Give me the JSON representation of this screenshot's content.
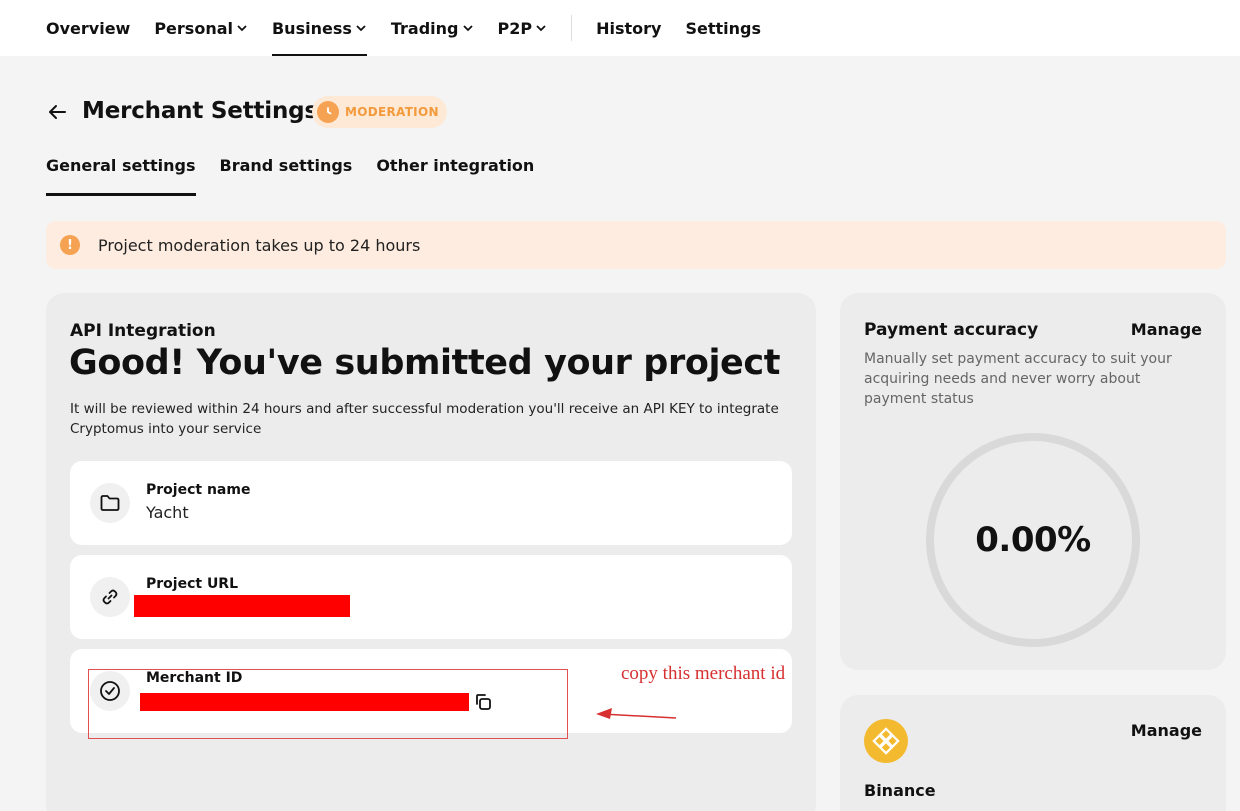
{
  "nav": {
    "items": [
      {
        "label": "Overview",
        "dropdown": false,
        "active": false
      },
      {
        "label": "Personal",
        "dropdown": true,
        "active": false
      },
      {
        "label": "Business",
        "dropdown": true,
        "active": true
      },
      {
        "label": "Trading",
        "dropdown": true,
        "active": false
      },
      {
        "label": "P2P",
        "dropdown": true,
        "active": false
      }
    ],
    "right_items": [
      {
        "label": "History"
      },
      {
        "label": "Settings"
      }
    ]
  },
  "header": {
    "title": "Merchant Settings",
    "status_badge": "MODERATION"
  },
  "tabs": [
    {
      "label": "General settings",
      "active": true
    },
    {
      "label": "Brand settings",
      "active": false
    },
    {
      "label": "Other integration",
      "active": false
    }
  ],
  "notice": {
    "icon": "!",
    "message": "Project moderation takes up to 24 hours"
  },
  "api": {
    "label": "API Integration",
    "headline": "Good! You've submitted your project",
    "description": "It will be reviewed within 24 hours and after successful moderation you'll receive an API KEY to integrate Cryptomus into your service",
    "fields": [
      {
        "label": "Project name",
        "value": "Yacht",
        "icon": "folder-icon"
      },
      {
        "label": "Project URL",
        "value": "",
        "icon": "link-icon",
        "redacted": true
      },
      {
        "label": "Merchant ID",
        "value": "",
        "icon": "check-circle-icon",
        "redacted": true
      }
    ]
  },
  "annotation": {
    "text": "copy this merchant id",
    "color": "#d63030"
  },
  "payment_accuracy": {
    "title": "Payment accuracy",
    "manage": "Manage",
    "description": "Manually set payment accuracy to suit your acquiring needs and never worry about payment status",
    "value": "0.00%"
  },
  "binance": {
    "name": "Binance",
    "manage": "Manage",
    "logo_color": "#f3ba2f"
  },
  "colors": {
    "accent_orange": "#f5a352",
    "notice_bg": "#fdecdf",
    "redaction": "#ff0000"
  }
}
